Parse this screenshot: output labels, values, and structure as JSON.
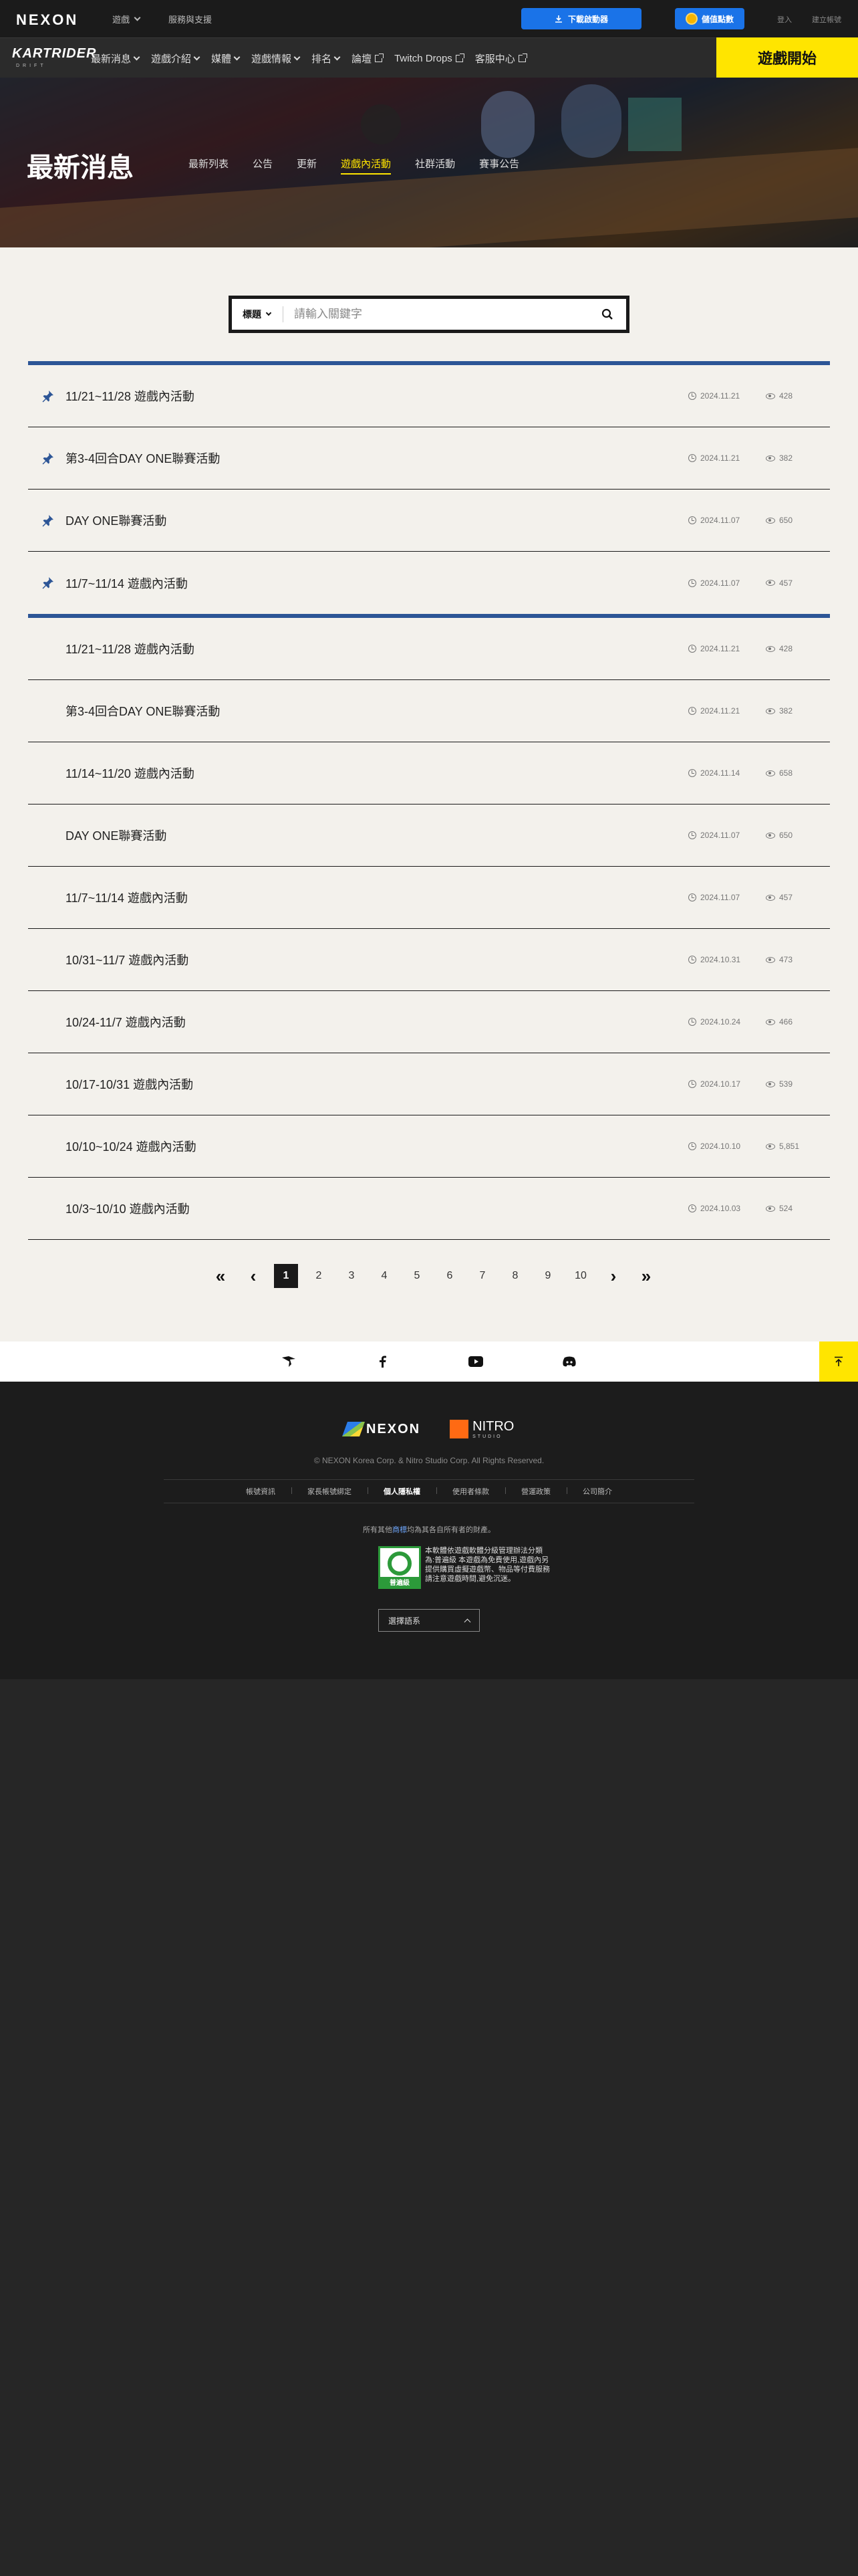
{
  "topbar": {
    "brand": "NEXON",
    "games_label": "遊戲",
    "support_label": "服務與支援",
    "download_label": "下載啟動器",
    "gift_label": "儲值點數",
    "login_label": "登入",
    "signup_label": "建立帳號"
  },
  "game_nav": {
    "logo": "KARTRIDER",
    "logo_sub": "DRIFT",
    "items": [
      {
        "label": "最新消息",
        "icon": "chevron-down-icon"
      },
      {
        "label": "遊戲介紹",
        "icon": "chevron-down-icon"
      },
      {
        "label": "媒體",
        "icon": "chevron-down-icon"
      },
      {
        "label": "遊戲情報",
        "icon": "chevron-down-icon"
      },
      {
        "label": "排名",
        "icon": "chevron-down-icon"
      },
      {
        "label": "論壇",
        "icon": "external-link-icon"
      },
      {
        "label": "Twitch Drops",
        "icon": "external-link-icon"
      },
      {
        "label": "客服中心",
        "icon": "external-link-icon"
      }
    ],
    "play_label": "遊戲開始"
  },
  "hero": {
    "title": "最新消息",
    "tabs": [
      "最新列表",
      "公告",
      "更新",
      "遊戲內活動",
      "社群活動",
      "賽事公告"
    ],
    "active_tab": "遊戲內活動"
  },
  "search": {
    "type_label": "標題",
    "placeholder": "請輸入關鍵字"
  },
  "pinned_posts": [
    {
      "title": "11/21~11/28 遊戲內活動",
      "date": "2024.11.21",
      "views": "428"
    },
    {
      "title": "第3-4回合DAY ONE聯賽活動",
      "date": "2024.11.21",
      "views": "382"
    },
    {
      "title": "DAY ONE聯賽活動",
      "date": "2024.11.07",
      "views": "650"
    },
    {
      "title": "11/7~11/14 遊戲內活動",
      "date": "2024.11.07",
      "views": "457"
    }
  ],
  "posts": [
    {
      "title": "11/21~11/28 遊戲內活動",
      "date": "2024.11.21",
      "views": "428"
    },
    {
      "title": "第3-4回合DAY ONE聯賽活動",
      "date": "2024.11.21",
      "views": "382"
    },
    {
      "title": "11/14~11/20 遊戲內活動",
      "date": "2024.11.14",
      "views": "658"
    },
    {
      "title": "DAY ONE聯賽活動",
      "date": "2024.11.07",
      "views": "650"
    },
    {
      "title": "11/7~11/14 遊戲內活動",
      "date": "2024.11.07",
      "views": "457"
    },
    {
      "title": "10/31~11/7 遊戲內活動",
      "date": "2024.10.31",
      "views": "473"
    },
    {
      "title": "10/24-11/7 遊戲內活動",
      "date": "2024.10.24",
      "views": "466"
    },
    {
      "title": "10/17-10/31 遊戲內活動",
      "date": "2024.10.17",
      "views": "539"
    },
    {
      "title": "10/10~10/24 遊戲內活動",
      "date": "2024.10.10",
      "views": "5,851"
    },
    {
      "title": "10/3~10/10 遊戲內活動",
      "date": "2024.10.03",
      "views": "524"
    }
  ],
  "pagination": {
    "first": "«",
    "prev": "‹",
    "pages": [
      "1",
      "2",
      "3",
      "4",
      "5",
      "6",
      "7",
      "8",
      "9",
      "10"
    ],
    "current": "1",
    "next": "›",
    "last": "»"
  },
  "social": [
    "studio-bird-icon",
    "facebook-icon",
    "youtube-icon",
    "discord-icon"
  ],
  "footer": {
    "nexon": "NEXON",
    "nitro": "NITRO",
    "nitro_sub": "STUDIO",
    "copyright": "© NEXON Korea Corp. & Nitro Studio Corp. All Rights Reserved.",
    "links": [
      "帳號資訊",
      "家長帳號綁定",
      "個人隱私權",
      "使用者條款",
      "營運政策",
      "公司簡介"
    ],
    "trademark_prefix": "所有其他",
    "trademark_highlight": "商標",
    "trademark_suffix": "均為其各自所有者的財產。",
    "rating_label": "普遍級",
    "rating_text": "本軟體依遊戲軟體分級管理辦法分類為:普遍級 本遊戲為免費使用,遊戲內另提供購買虛擬遊戲幣、物品等付費服務 請注意遊戲時間,避免沉迷。",
    "region_label": "選擇語系"
  },
  "colors": {
    "accent_yellow": "#ffe500",
    "brand_blue": "#1a73e8",
    "pinned_border": "#2c5596"
  }
}
